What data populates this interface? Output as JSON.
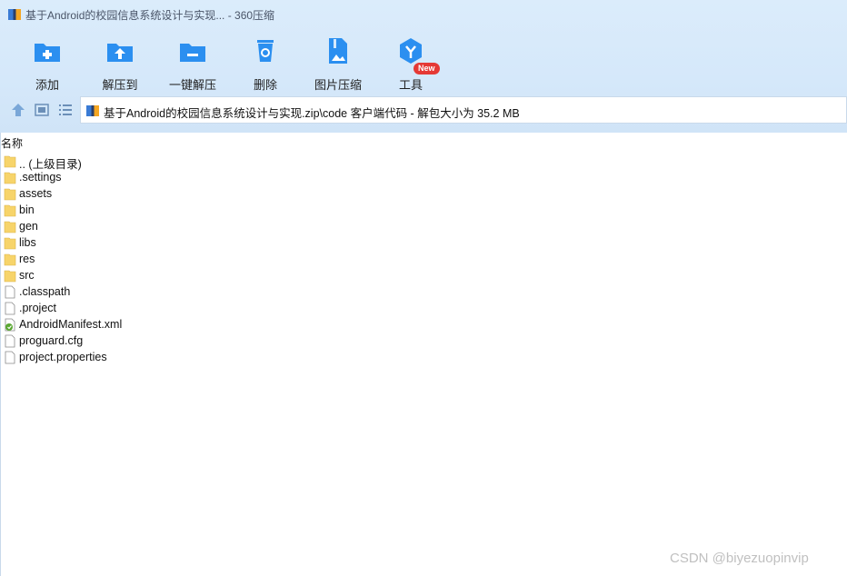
{
  "window": {
    "title": "基于Android的校园信息系统设计与实现... - 360压缩",
    "app_icon": "archive-app-icon"
  },
  "toolbar": {
    "items": [
      {
        "label": "添加",
        "icon": "add-folder-icon"
      },
      {
        "label": "解压到",
        "icon": "extract-to-icon"
      },
      {
        "label": "一键解压",
        "icon": "one-click-extract-icon"
      },
      {
        "label": "删除",
        "icon": "recycle-bin-icon"
      },
      {
        "label": "图片压缩",
        "icon": "image-compress-icon"
      },
      {
        "label": "工具",
        "icon": "tools-cube-icon"
      }
    ],
    "new_badge": "New"
  },
  "navigation": {
    "up_icon": "arrow-up-icon",
    "thumb_view_icon": "thumbnail-view-icon",
    "list_view_icon": "list-view-icon",
    "path": "基于Android的校园信息系统设计与实现.zip\\code 客户端代码 - 解包大小为 35.2 MB"
  },
  "columns": {
    "name": "名称"
  },
  "files": [
    {
      "name": ".. (上级目录)",
      "type": "folder"
    },
    {
      "name": ".settings",
      "type": "folder"
    },
    {
      "name": "assets",
      "type": "folder"
    },
    {
      "name": "bin",
      "type": "folder"
    },
    {
      "name": "gen",
      "type": "folder"
    },
    {
      "name": "libs",
      "type": "folder"
    },
    {
      "name": "res",
      "type": "folder"
    },
    {
      "name": "src",
      "type": "folder"
    },
    {
      "name": ".classpath",
      "type": "file"
    },
    {
      "name": ".project",
      "type": "file"
    },
    {
      "name": "AndroidManifest.xml",
      "type": "xml"
    },
    {
      "name": "proguard.cfg",
      "type": "file"
    },
    {
      "name": "project.properties",
      "type": "file"
    }
  ],
  "watermark": "CSDN @biyezuopinvip",
  "colors": {
    "accent": "#2b8ff0",
    "folder": "#f7d46a",
    "badge": "#e53935"
  }
}
